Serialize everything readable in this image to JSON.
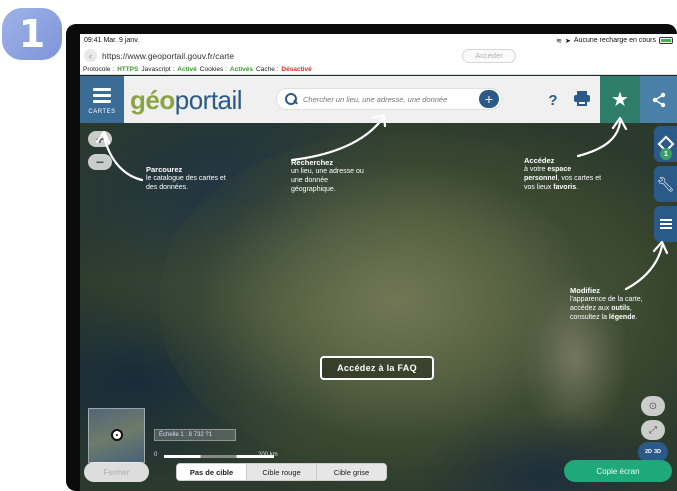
{
  "step": {
    "number": "1"
  },
  "statusbar": {
    "time_date": "09:41  Mar. 9 janv.",
    "network": "Aucune recharge en cours"
  },
  "urlbar": {
    "url": "https://www.geoportail.gouv.fr/carte",
    "go_label": "Accéder"
  },
  "infobar": {
    "protocol_label": "Protocole :",
    "protocol_value": "HTTPS",
    "javascript_label": "Javascript :",
    "javascript_value": "Activé",
    "cookies_label": "Cookies :",
    "cookies_value": "Activés",
    "cache_label": "Cache :",
    "cache_value": "Désactivé"
  },
  "toolbar": {
    "menu_label": "CARTES",
    "logo_geo": "géo",
    "logo_portail": "portail",
    "search_placeholder": "Chercher un lieu, une adresse, une donnée",
    "plus_label": "+",
    "help_label": "?"
  },
  "right_rail": {
    "layer_count": "1"
  },
  "annotations": {
    "catalog": {
      "title": "Parcourez",
      "line1": "le catalogue des cartes et",
      "line2": "des données."
    },
    "search": {
      "title": "Recherchez",
      "line1": "un lieu, une adresse ou",
      "line2": "une donnée",
      "line3": "géographique."
    },
    "account": {
      "title": "Accédez",
      "line1_pre": "à votre ",
      "line1_bold": "espace",
      "line2_bold": "personnel",
      "line2_post": ", vos cartes et",
      "line3_pre": "vos lieux ",
      "line3_bold": "favoris",
      "line3_post": "."
    },
    "tools": {
      "title": "Modifiez",
      "line1": "l'apparence de la carte,",
      "line2_pre": "accédez aux ",
      "line2_bold": "outils",
      "line2_post": ",",
      "line3_pre": "consultez la ",
      "line3_bold": "légende",
      "line3_post": "."
    }
  },
  "faq_button": "Accédez à la FAQ",
  "scale": {
    "ratio": "Échelle 1 : 8 732 ?1",
    "start": "0",
    "end": "200 km"
  },
  "view3d": {
    "a": "2D",
    "b": "3D"
  },
  "bottombar": {
    "close_label": "Fermer",
    "segments": [
      "Pas de cible",
      "Cible rouge",
      "Cible grise"
    ],
    "capture_label": "Copie écran"
  },
  "colors": {
    "brand_blue": "#2b5a88",
    "favorites_green": "#2e7d6b",
    "capture_green": "#1fa87a",
    "badge_blue": "#8ea4e2"
  }
}
